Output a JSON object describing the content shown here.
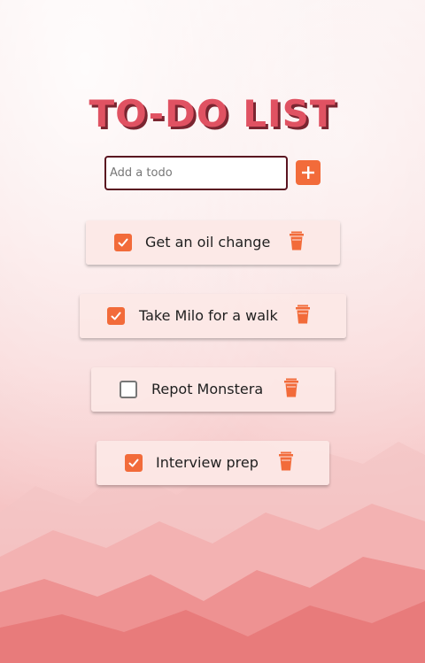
{
  "title": "TO-DO LIST",
  "add": {
    "placeholder": "Add a todo",
    "button_icon": "plus-icon"
  },
  "todos": [
    {
      "text": "Get an oil change",
      "checked": true
    },
    {
      "text": "Take Milo for a walk",
      "checked": true
    },
    {
      "text": "Repot Monstera",
      "checked": false
    },
    {
      "text": "Interview prep",
      "checked": true
    }
  ],
  "colors": {
    "accent": "#f26b3a",
    "title": "#e05262",
    "title_shadow": "#7a2530",
    "card": "#fce8e6"
  },
  "icons": {
    "checkbox": "checkmark-icon",
    "delete": "trash-icon"
  }
}
